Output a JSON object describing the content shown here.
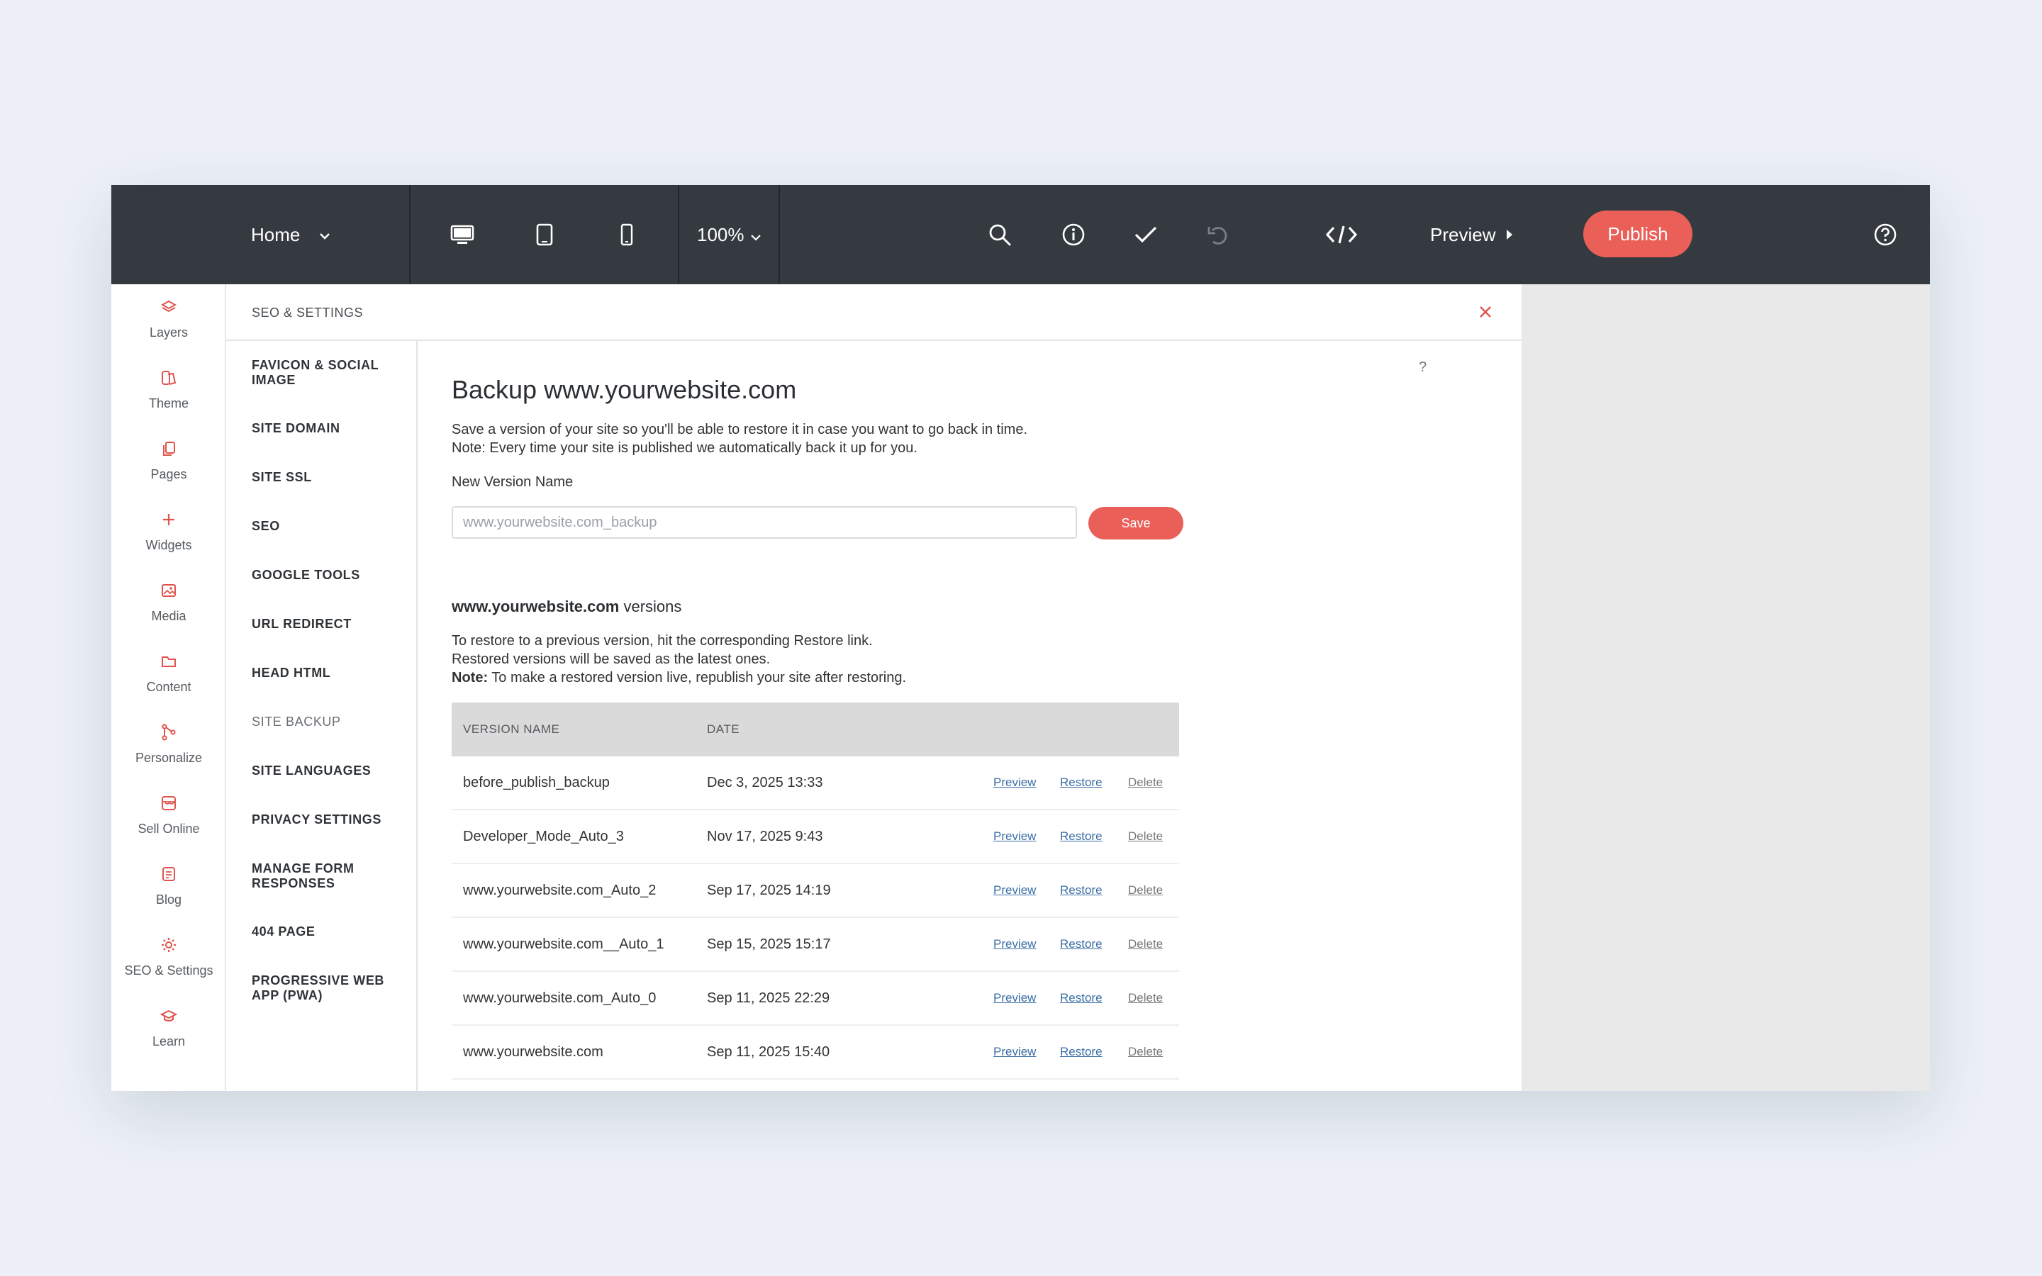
{
  "topbar": {
    "page_label": "Home",
    "zoom": "100%",
    "preview_label": "Preview",
    "publish_label": "Publish"
  },
  "rail": [
    {
      "label": "Layers",
      "icon": "layers-icon"
    },
    {
      "label": "Theme",
      "icon": "theme-icon"
    },
    {
      "label": "Pages",
      "icon": "pages-icon"
    },
    {
      "label": "Widgets",
      "icon": "plus-icon"
    },
    {
      "label": "Media",
      "icon": "image-icon"
    },
    {
      "label": "Content",
      "icon": "folder-icon"
    },
    {
      "label": "Personalize",
      "icon": "branch-icon"
    },
    {
      "label": "Sell Online",
      "icon": "store-icon"
    },
    {
      "label": "Blog",
      "icon": "blog-icon"
    },
    {
      "label": "SEO & Settings",
      "icon": "gear-icon"
    },
    {
      "label": "Learn",
      "icon": "graduation-cap-icon"
    }
  ],
  "panel": {
    "title": "SEO & SETTINGS",
    "subnav": [
      "FAVICON & SOCIAL IMAGE",
      "SITE DOMAIN",
      "SITE SSL",
      "SEO",
      "GOOGLE TOOLS",
      "URL REDIRECT",
      "HEAD HTML",
      "SITE BACKUP",
      "SITE LANGUAGES",
      "PRIVACY SETTINGS",
      "MANAGE FORM RESPONSES",
      "404 PAGE",
      "PROGRESSIVE WEB APP (PWA)"
    ],
    "active_subnav": "SITE BACKUP"
  },
  "backup": {
    "help": "?",
    "heading": "Backup www.yourwebsite.com",
    "desc_line1": "Save a version of your site so you'll be able to restore it in case you want to go back in time.",
    "desc_line2": "Note: Every time your site is published we automatically back it up for you.",
    "field_label": "New Version Name",
    "input_placeholder": "www.yourwebsite.com_backup",
    "save_label": "Save",
    "versions_site": "www.yourwebsite.com",
    "versions_suffix": " versions",
    "restore_line1": "To restore to a previous version, hit the corresponding Restore link.",
    "restore_line2": "Restored versions will be saved as the latest ones.",
    "restore_note_bold": "Note:",
    "restore_note_text": " To make a restored version live, republish your site after restoring."
  },
  "table": {
    "headers": {
      "name": "VERSION NAME",
      "date": "DATE"
    },
    "actions": {
      "preview": "Preview",
      "restore": "Restore",
      "delete": "Delete"
    },
    "rows": [
      {
        "name": "before_publish_backup",
        "date": "Dec 3, 2025 13:33"
      },
      {
        "name": "Developer_Mode_Auto_3",
        "date": "Nov 17, 2025 9:43"
      },
      {
        "name": "www.yourwebsite.com_Auto_2",
        "date": "Sep 17, 2025 14:19"
      },
      {
        "name": "www.yourwebsite.com__Auto_1",
        "date": "Sep 15, 2025 15:17"
      },
      {
        "name": "www.yourwebsite.com_Auto_0",
        "date": "Sep 11, 2025 22:29"
      },
      {
        "name": "www.yourwebsite.com",
        "date": "Sep 11, 2025 15:40"
      }
    ]
  },
  "colors": {
    "accent": "#ea5f58",
    "topbar": "#343a3f",
    "link": "#3a6ea5"
  }
}
